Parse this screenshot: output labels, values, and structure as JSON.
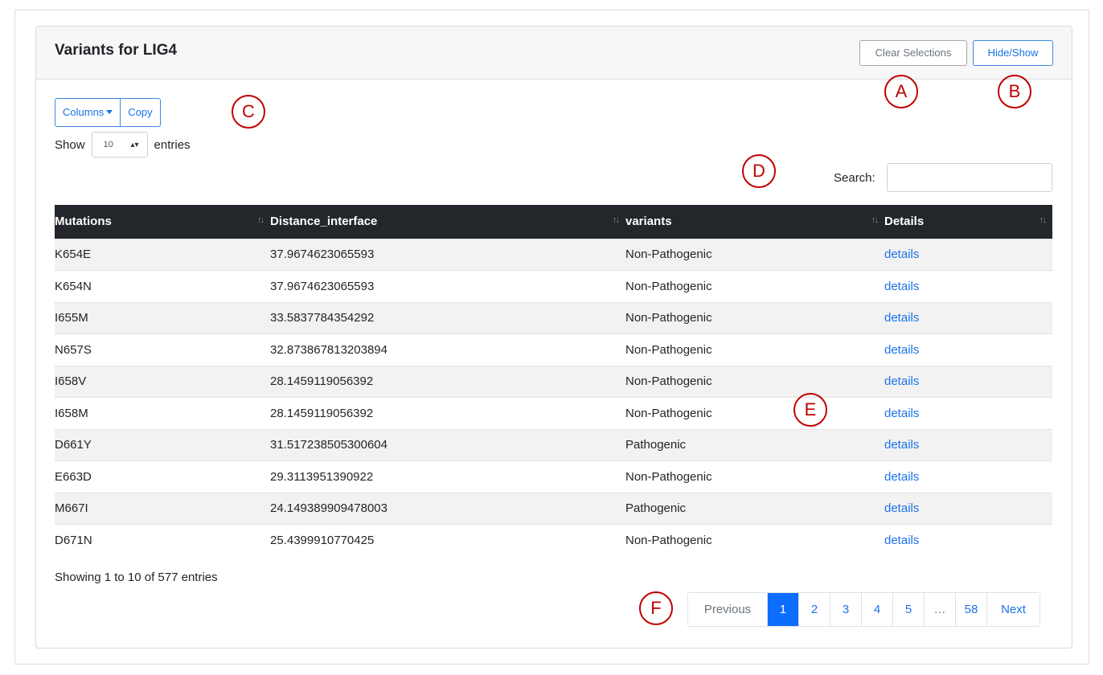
{
  "card": {
    "title": "Variants for LIG4",
    "clear_label": "Clear Selections",
    "hide_label": "Hide/Show"
  },
  "toolbar": {
    "columns_label": "Columns",
    "copy_label": "Copy"
  },
  "length_menu": {
    "show_label": "Show",
    "selected_value": "10",
    "entries_label": "entries"
  },
  "search": {
    "label": "Search:",
    "value": ""
  },
  "table": {
    "headers": [
      "Mutations",
      "Distance_interface",
      "variants",
      "Details"
    ],
    "rows": [
      [
        "K654E",
        "37.9674623065593",
        "Non-Pathogenic",
        "details"
      ],
      [
        "K654N",
        "37.9674623065593",
        "Non-Pathogenic",
        "details"
      ],
      [
        "I655M",
        "33.5837784354292",
        "Non-Pathogenic",
        "details"
      ],
      [
        "N657S",
        "32.873867813203894",
        "Non-Pathogenic",
        "details"
      ],
      [
        "I658V",
        "28.1459119056392",
        "Non-Pathogenic",
        "details"
      ],
      [
        "I658M",
        "28.1459119056392",
        "Non-Pathogenic",
        "details"
      ],
      [
        "D661Y",
        "31.517238505300604",
        "Pathogenic",
        "details"
      ],
      [
        "E663D",
        "29.3113951390922",
        "Non-Pathogenic",
        "details"
      ],
      [
        "M667I",
        "24.149389909478003",
        "Pathogenic",
        "details"
      ],
      [
        "D671N",
        "25.4399910770425",
        "Non-Pathogenic",
        "details"
      ]
    ]
  },
  "info": "Showing 1 to 10 of 577 entries",
  "pagination": {
    "previous": "Previous",
    "pages": [
      "1",
      "2",
      "3",
      "4",
      "5"
    ],
    "ellipsis": "…",
    "last_page": "58",
    "next": "Next",
    "active": "1"
  },
  "markers": [
    "A",
    "B",
    "C",
    "D",
    "E",
    "F"
  ],
  "colors": {
    "accent": "#1a73e8",
    "active_page": "#0d6efd",
    "header_bg": "#23262b",
    "marker": "#c00000"
  },
  "icons": {
    "sort": "sort-arrows-icon",
    "caret": "caret-down-icon",
    "select": "up-down-arrows-icon"
  }
}
